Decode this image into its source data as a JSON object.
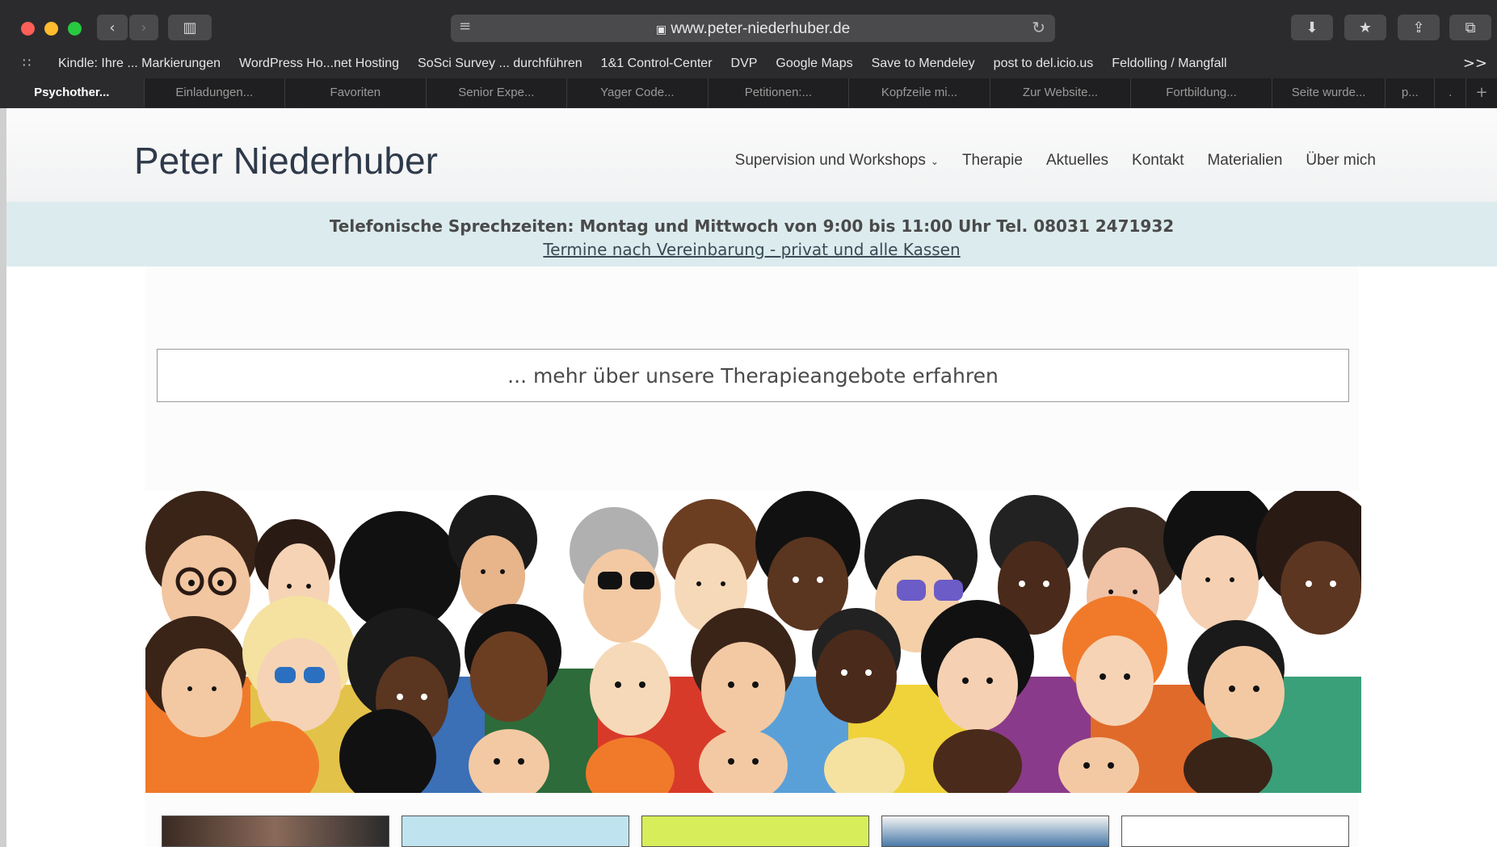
{
  "browser": {
    "url": "www.peter-niederhuber.de",
    "lock_icon": "lock-icon",
    "bookmarks": [
      "Kindle: Ihre ... Markierungen",
      "WordPress Ho...net Hosting",
      "SoSci Survey ... durchführen",
      "1&1 Control-Center",
      "DVP",
      "Google Maps",
      "Save to Mendeley",
      "post to del.icio.us",
      "Feldolling / Mangfall"
    ],
    "more_label": ">>",
    "tabs": [
      "Psychother...",
      "Einladungen...",
      "Favoriten",
      "Senior Expe...",
      "Yager Code...",
      "Petitionen:...",
      "Kopfzeile mi...",
      "Zur Website...",
      "Fortbildung...",
      "Seite wurde...",
      "p...",
      "."
    ],
    "new_tab_label": "+"
  },
  "site": {
    "title": "Peter Niederhuber",
    "nav": [
      "Supervision und Workshops",
      "Therapie",
      "Aktuelles",
      "Kontakt",
      "Materialien",
      "Über mich"
    ],
    "notice_line1": "Telefonische Sprechzeiten: Montag und Mittwoch von 9:00 bis 11:00 Uhr Tel. 08031 2471932",
    "notice_line2": "Termine nach Vereinbarung - privat und alle Kassen",
    "cta_label": "... mehr über unsere Therapieangebote erfahren"
  },
  "colors": {
    "chrome": "#2b2b2d",
    "notice_bg": "#dcebee",
    "title": "#2e3a4a"
  }
}
